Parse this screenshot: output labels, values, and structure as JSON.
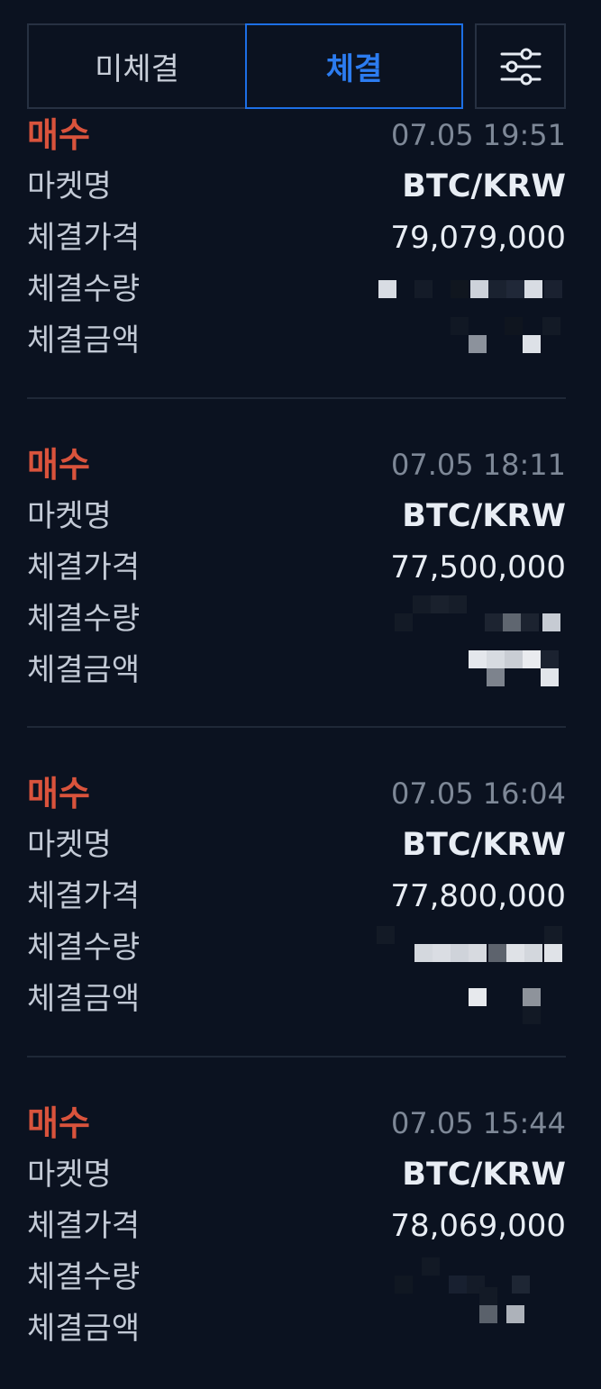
{
  "tabs": {
    "unfilled_label": "미체결",
    "filled_label": "체결",
    "active": "filled"
  },
  "filter": {
    "icon": "sliders-icon"
  },
  "labels": {
    "market": "마켓명",
    "price": "체결가격",
    "quantity": "체결수량",
    "amount": "체결금액"
  },
  "colors": {
    "background": "#0b1220",
    "buy": "#d9533c",
    "active_tab": "#1d6fe5"
  },
  "orders": [
    {
      "side": "매수",
      "time": "07.05 19:51",
      "market": "BTC/KRW",
      "price": "79,079,000",
      "quantity_redacted": true,
      "amount_redacted": true
    },
    {
      "side": "매수",
      "time": "07.05 18:11",
      "market": "BTC/KRW",
      "price": "77,500,000",
      "quantity_redacted": true,
      "amount_redacted": true
    },
    {
      "side": "매수",
      "time": "07.05 16:04",
      "market": "BTC/KRW",
      "price": "77,800,000",
      "quantity_redacted": true,
      "amount_redacted": true
    },
    {
      "side": "매수",
      "time": "07.05 15:44",
      "market": "BTC/KRW",
      "price": "78,069,000",
      "quantity_redacted": true,
      "amount_redacted": true
    }
  ]
}
